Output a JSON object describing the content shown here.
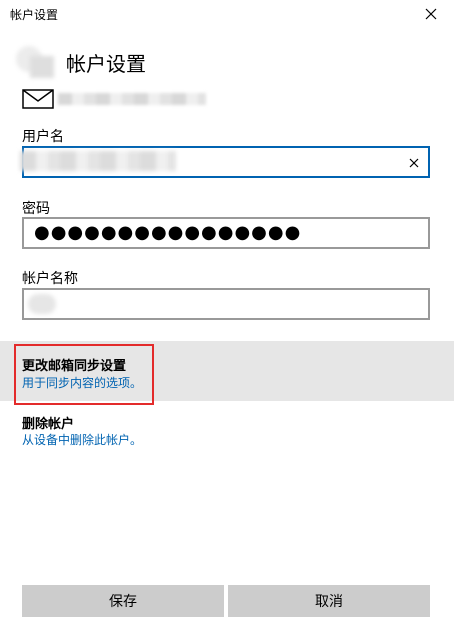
{
  "window": {
    "title": "帐户设置"
  },
  "header": {
    "heading": "帐户设置"
  },
  "form": {
    "username_label": "用户名",
    "username_value": "",
    "password_label": "密码",
    "password_value": "●●●●●●●●●●●●●●●●",
    "account_name_label": "帐户名称",
    "account_name_value": ""
  },
  "options": [
    {
      "title": "更改邮箱同步设置",
      "description": "用于同步内容的选项。"
    },
    {
      "title": "删除帐户",
      "description": "从设备中删除此帐户。"
    }
  ],
  "buttons": {
    "save": "保存",
    "cancel": "取消"
  },
  "colors": {
    "accent": "#0063b1",
    "highlight_box": "#e32b2b",
    "button_bg": "#cccccc",
    "selected_row_bg": "#e6e6e6"
  },
  "icons": {
    "close": "close-icon",
    "mail": "mail-icon",
    "clear": "clear-icon"
  }
}
